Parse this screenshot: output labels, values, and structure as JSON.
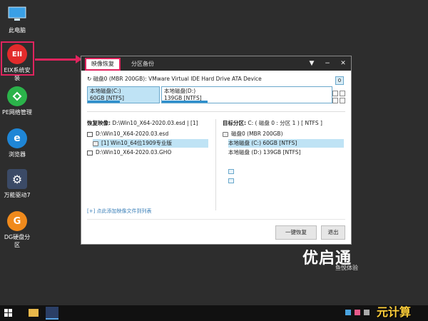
{
  "desktop": {
    "icons": [
      {
        "label": "此电脑",
        "icon": "computer-icon"
      },
      {
        "label": "EIX系统安装",
        "icon": "eix-icon",
        "glyph": "EII"
      },
      {
        "label": "PE网络管理",
        "icon": "network-icon"
      },
      {
        "label": "浏览器",
        "icon": "browser-icon"
      },
      {
        "label": "万能驱动7",
        "icon": "gear-icon"
      },
      {
        "label": "DG硬盘分区",
        "icon": "dg-icon",
        "glyph": "G"
      }
    ]
  },
  "window": {
    "tabs": [
      "映像恢复",
      "分区备份"
    ],
    "disk_header": "磁盘0 (MBR 200GB): VMware Virtual IDE Hard Drive ATA Device",
    "disk_badge": "0",
    "partitions": [
      {
        "name": "本地磁盘(C:)",
        "size": "60GB [NTFS]",
        "used_fraction": 0.45
      },
      {
        "name": "本地磁盘(D:)",
        "size": "139GB [NTFS]",
        "used_fraction": 0.27
      }
    ],
    "restore_image_label": "恢复映像:",
    "restore_image_path": "D:\\Win10_X64-2020.03.esd | [1]",
    "left_tree": [
      {
        "text": "D:\\Win10_X64-2020.03.esd",
        "icon": "monitor-icon"
      },
      {
        "text": "[1] Win10_64位1909专业版",
        "icon": "disk-icon",
        "selected": true
      },
      {
        "text": "D:\\Win10_X64-2020.03.GHO",
        "icon": "monitor-icon"
      }
    ],
    "target_label": "目标分区:",
    "target_value": "C: ( 磁盘 0 : 分区 1 ) [ NTFS ]",
    "right_tree": [
      {
        "text": "磁盘0 (MBR 200GB)",
        "icon": "disk-icon"
      },
      {
        "text": "本地磁盘 (C:) 60GB [NTFS]",
        "icon": "partition-icon",
        "selected": true
      },
      {
        "text": "本地磁盘 (D:) 139GB [NTFS]",
        "icon": "partition-icon"
      }
    ],
    "add_image_link": "[+] 点此添加映像文件到列表",
    "restore_button": "一键恢复",
    "exit_button": "退出"
  },
  "brand": {
    "logo": "优启通",
    "subtitle": "鱼悦体验"
  },
  "watermark": "元计算",
  "colors": {
    "highlight": "#e0245e",
    "accent": "#2f8fcc",
    "selection": "#bfe3f5"
  }
}
